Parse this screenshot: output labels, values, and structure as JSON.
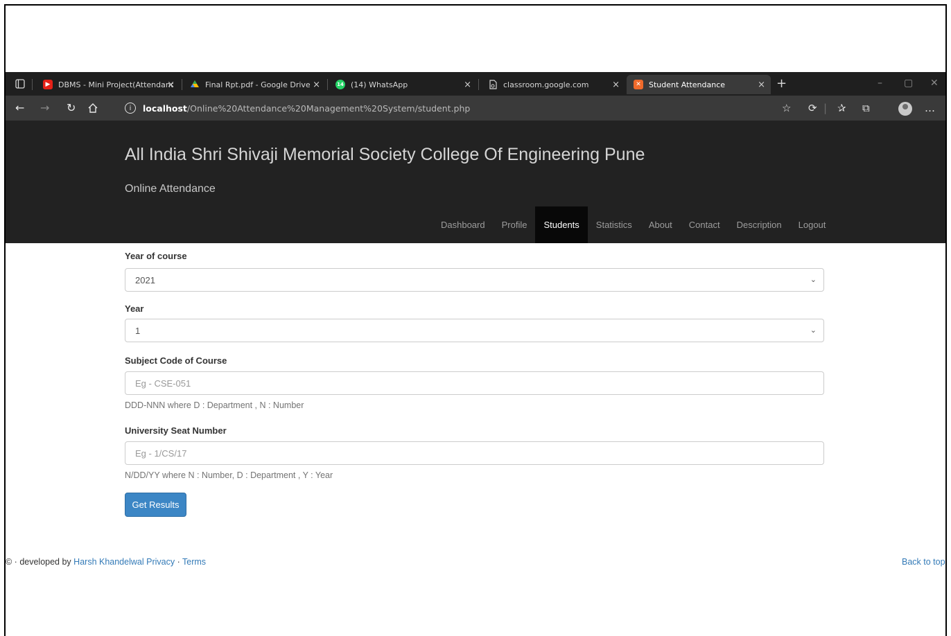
{
  "browser": {
    "tabs": [
      {
        "label": "DBMS - Mini Project(Attendance",
        "icon": "youtube-icon",
        "active": false
      },
      {
        "label": "Final Rpt.pdf - Google Drive",
        "icon": "google-drive-icon",
        "active": false
      },
      {
        "label": "(14) WhatsApp",
        "icon": "whatsapp-icon",
        "active": false,
        "badge": "14"
      },
      {
        "label": "classroom.google.com",
        "icon": "page-icon",
        "active": false
      },
      {
        "label": "Student Attendance",
        "icon": "xampp-icon",
        "active": true
      }
    ],
    "url_host": "localhost",
    "url_path": "/Online%20Attendance%20Management%20System/student.php",
    "colors": {
      "tabstrip": "#1f1f1f",
      "toolbar": "#3a3a3a"
    }
  },
  "site": {
    "title": "All India Shri Shivaji Memorial Society College Of Engineering Pune",
    "subtitle": "Online Attendance",
    "nav": [
      "Dashboard",
      "Profile",
      "Students",
      "Statistics",
      "About",
      "Contact",
      "Description",
      "Logout"
    ],
    "active_nav": "Students",
    "header_color": "#222222"
  },
  "form": {
    "year_of_course": {
      "label": "Year of course",
      "value": "2021"
    },
    "year": {
      "label": "Year",
      "value": "1"
    },
    "subject_code": {
      "label": "Subject Code of Course",
      "placeholder": "Eg - CSE-051",
      "help": "DDD-NNN where D : Department , N : Number"
    },
    "seat_number": {
      "label": "University Seat Number",
      "placeholder": "Eg - 1/CS/17",
      "help": "N/DD/YY where N : Number, D : Department , Y : Year"
    },
    "submit_label": "Get Results",
    "button_color": "#3c86c5"
  },
  "footer": {
    "prefix": "© · developed by",
    "author": "Harsh Khandelwal",
    "privacy": "Privacy",
    "separator": "·",
    "terms": "Terms",
    "back_to_top": "Back to top"
  }
}
